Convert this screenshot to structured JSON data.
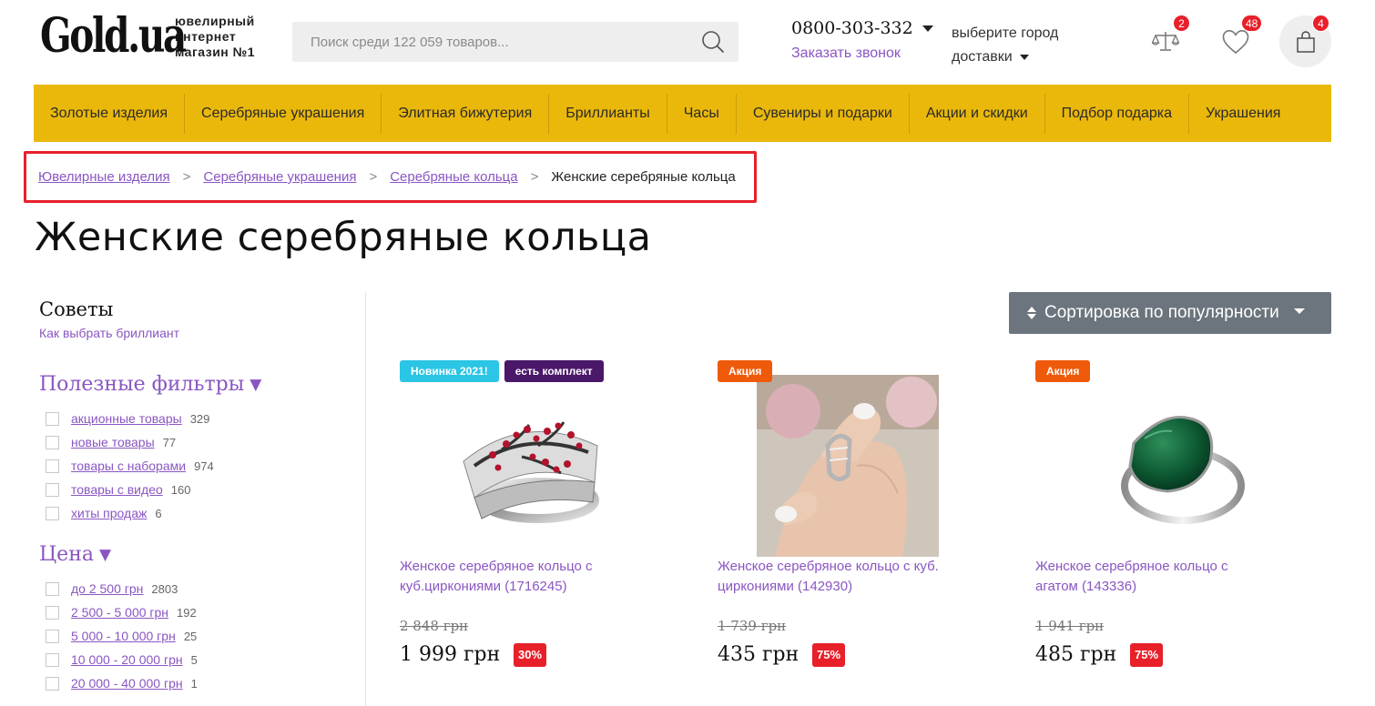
{
  "header": {
    "logo_text": "Gold.ua",
    "logo_tagline": [
      "ювелирный",
      "интернет",
      "магазин №1"
    ],
    "search_placeholder": "Поиск среди 122 059 товаров...",
    "phone": "0800-303-332",
    "callback": "Заказать звонок",
    "city_line1": "выберите город",
    "city_line2": "доставки",
    "compare_count": "2",
    "wishlist_count": "48",
    "cart_count": "4"
  },
  "nav": [
    "Золотые изделия",
    "Серебряные украшения",
    "Элитная бижутерия",
    "Бриллианты",
    "Часы",
    "Сувениры и подарки",
    "Акции и скидки",
    "Подбор подарка",
    "Украшения"
  ],
  "breadcrumb": {
    "items": [
      "Ювелирные изделия",
      "Серебряные украшения",
      "Серебряные кольца"
    ],
    "separator": ">",
    "current": "Женские серебряные кольца"
  },
  "page_title": "Женские серебряные кольца",
  "sidebar": {
    "tips_title": "Советы",
    "tips_link": "Как выбрать бриллиант",
    "useful_title": "Полезные фильтры",
    "useful": [
      {
        "label": "акционные товары",
        "count": "329"
      },
      {
        "label": "новые товары",
        "count": "77"
      },
      {
        "label": "товары с наборами",
        "count": "974"
      },
      {
        "label": "товары с видео",
        "count": "160"
      },
      {
        "label": "хиты продаж",
        "count": "6"
      }
    ],
    "price_title": "Цена",
    "price": [
      {
        "label": "до 2 500 грн",
        "count": "2803"
      },
      {
        "label": "2 500 - 5 000 грн",
        "count": "192"
      },
      {
        "label": "5 000 - 10 000 грн",
        "count": "25"
      },
      {
        "label": "10 000 - 20 000 грн",
        "count": "5"
      },
      {
        "label": "20 000 - 40 000 грн",
        "count": "1"
      }
    ]
  },
  "sort_label": "Сортировка по популярности",
  "products": [
    {
      "labels": [
        "Новинка 2021!",
        "есть комплект"
      ],
      "name": "Женское серебряное кольцо с куб.циркониями (1716245)",
      "old_price": "2 848 грн",
      "price": "1 999 грн",
      "discount": "30%"
    },
    {
      "labels": [
        "Акция"
      ],
      "name": "Женское серебряное кольцо с куб. циркониями (142930)",
      "old_price": "1 739 грн",
      "price": "435 грн",
      "discount": "75%"
    },
    {
      "labels": [
        "Акция"
      ],
      "name": "Женское серебряное кольцо с агатом (143336)",
      "old_price": "1 941 грн",
      "price": "485 грн",
      "discount": "75%"
    }
  ],
  "colors": {
    "accent": "#8a56c2",
    "nav_bg": "#eab80b",
    "badge_red": "#e8202a",
    "label_new": "#2bc5e5",
    "label_set": "#4a1769",
    "label_promo": "#ef5a0a",
    "sort_bg": "#6c757d"
  },
  "icons": {
    "search": "search-icon",
    "compare": "scales-icon",
    "wishlist": "heart-icon",
    "cart": "shopping-bag-icon"
  }
}
